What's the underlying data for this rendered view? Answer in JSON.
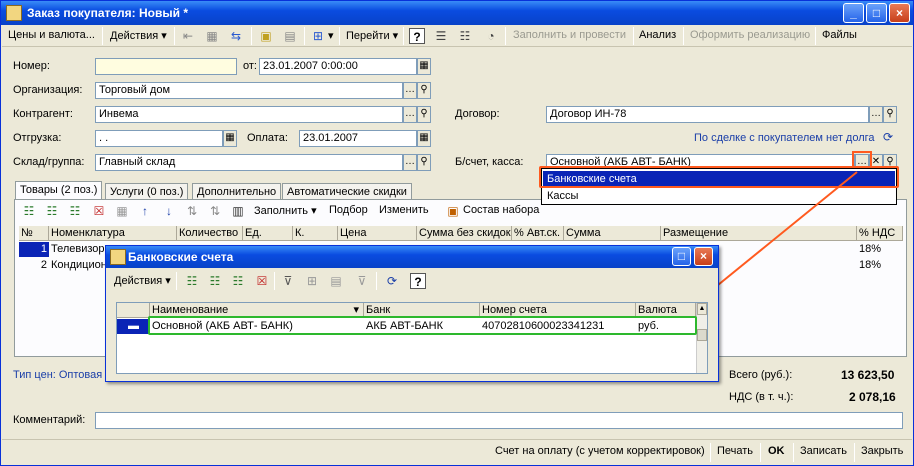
{
  "window": {
    "title": "Заказ покупателя: Новый *",
    "controls": [
      "_",
      "□",
      "×"
    ]
  },
  "toolbar": {
    "prices_currency": "Цены и валюта...",
    "actions": "Действия",
    "navigate": "Перейти",
    "help": "?",
    "fill_and_post": "Заполнить и провести",
    "analysis": "Анализ",
    "create_sale": "Оформить реализацию",
    "files": "Файлы"
  },
  "form": {
    "number_label": "Номер:",
    "number_value": "",
    "from_label": "от:",
    "date_value": "23.01.2007  0:00:00",
    "org_label": "Организация:",
    "org_value": "Торговый дом",
    "contractor_label": "Контрагент:",
    "contractor_value": "Инвема",
    "contract_label": "Договор:",
    "contract_value": "Договор ИН-78",
    "shipment_label": "Отгрузка:",
    "shipment_value": "  .  .",
    "payment_label": "Оплата:",
    "payment_value": "23.01.2007",
    "debt_link": "По сделке с покупателем нет долга",
    "warehouse_label": "Склад/группа:",
    "warehouse_value": "Главный склад",
    "account_label": "Б/счет, касса:",
    "account_value": "Основной  (АКБ АВТ- БАНК)",
    "comment_label": "Комментарий:",
    "comment_value": ""
  },
  "dropdown": {
    "items": [
      "Банковские счета",
      "Кассы"
    ]
  },
  "tabs": {
    "goods": "Товары (2 поз.)",
    "services": "Услуги (0 поз.)",
    "additional": "Дополнительно",
    "discounts": "Автоматические скидки"
  },
  "goods_toolbar": {
    "fill": "Заполнить",
    "selection": "Подбор",
    "change": "Изменить",
    "set_composition": "Состав набора"
  },
  "goods_table": {
    "headers": [
      "№",
      "Номенклатура",
      "Количество",
      "Ед.",
      "К.",
      "Цена",
      "Сумма без скидок",
      "% Авт.ск.",
      "Сумма",
      "Размещение",
      "% НДС"
    ],
    "rows": [
      {
        "num": "1",
        "name": "Телевизор",
        "vat": "18%"
      },
      {
        "num": "2",
        "name": "Кондицион",
        "vat": "18%"
      }
    ]
  },
  "footer": {
    "price_type": "Тип цен: Оптовая",
    "total_label": "Всего (руб.):",
    "total_value": "13 623,50",
    "vat_label": "НДС (в т. ч.):",
    "vat_value": "2 078,16"
  },
  "popup": {
    "title": "Банковские счета",
    "actions": "Действия",
    "help": "?",
    "headers": [
      "Наименование",
      "Банк",
      "Номер счета",
      "Валюта"
    ],
    "rows": [
      {
        "name": "Основной  (АКБ АВТ- БАНК)",
        "bank": "АКБ АВТ-БАНК",
        "account": "40702810600023341231",
        "currency": "руб."
      }
    ]
  },
  "buttons": {
    "invoice": "Счет на оплату (с учетом корректировок)",
    "print": "Печать",
    "ok": "OK",
    "save": "Записать",
    "close": "Закрыть"
  },
  "colors": {
    "title_blue": "#0a4ce0",
    "highlight_orange": "#ff5a1f",
    "highlight_green": "#2db82d",
    "selection_blue": "#0a24b6"
  }
}
